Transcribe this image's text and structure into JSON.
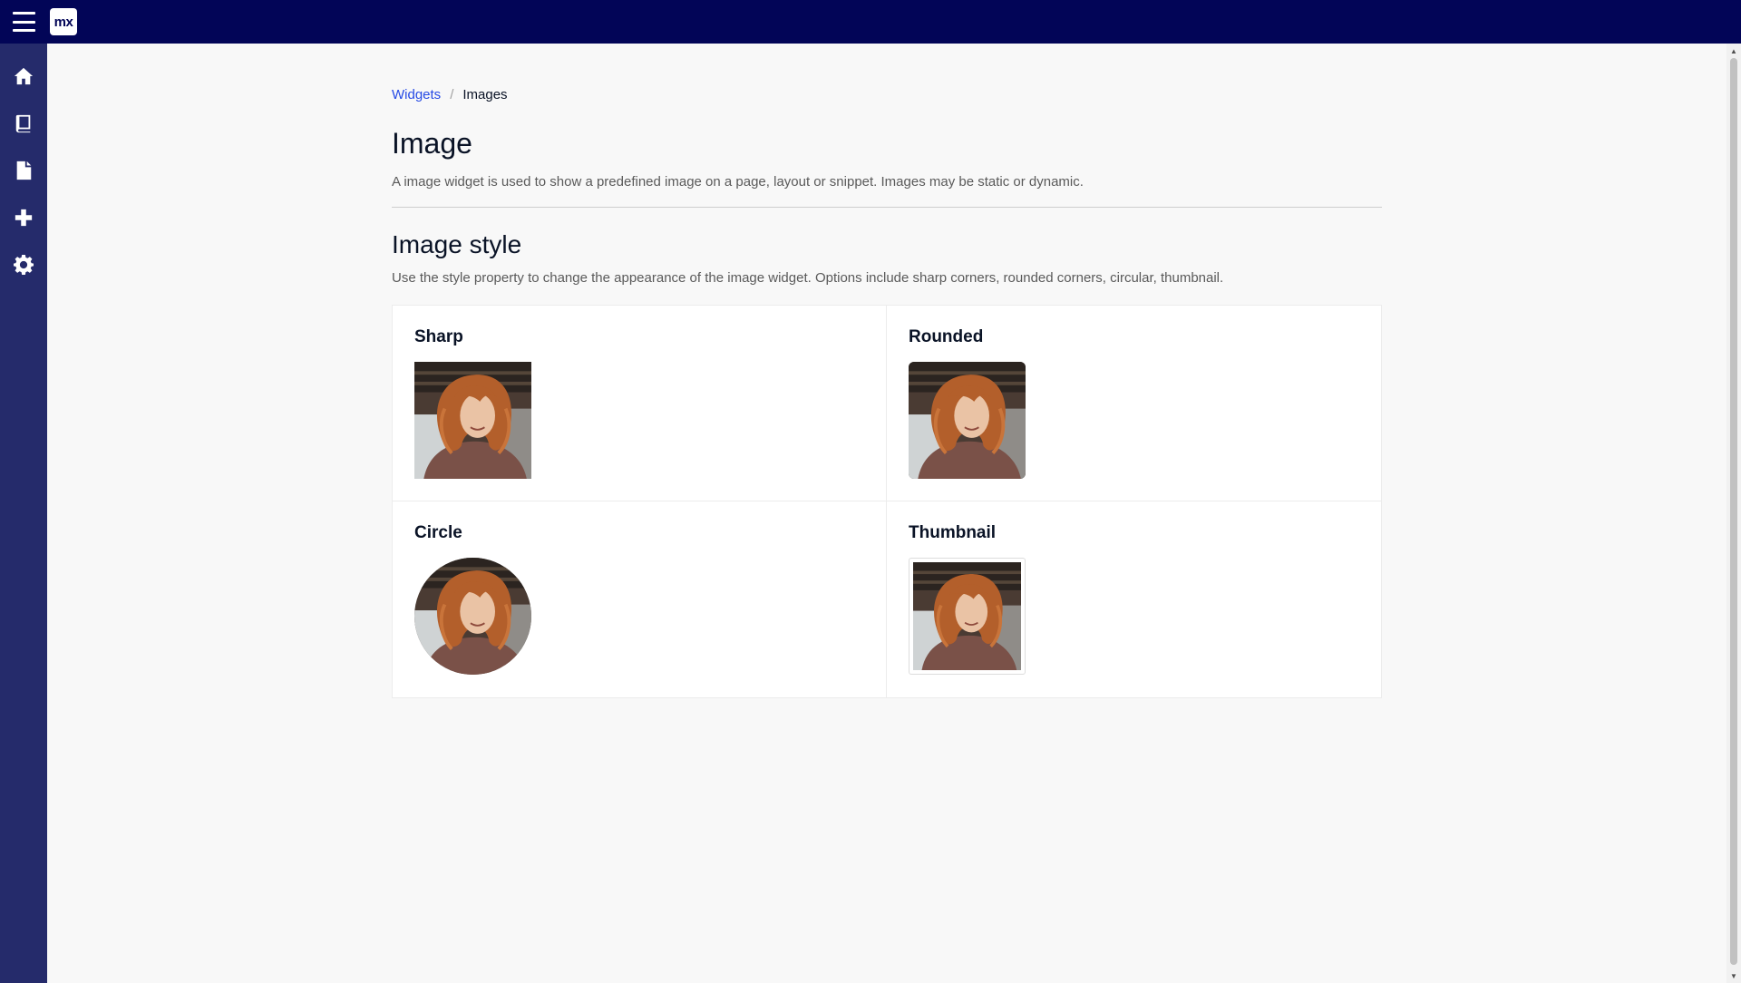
{
  "app": {
    "logo_text": "mx",
    "menu_icon": "hamburger-icon",
    "colors": {
      "topbar": "#020557",
      "sidebar": "#252b6b",
      "link": "#264ae5"
    }
  },
  "sidebar": {
    "items": [
      {
        "name": "home",
        "icon": "home-icon"
      },
      {
        "name": "book",
        "icon": "book-icon"
      },
      {
        "name": "document",
        "icon": "document-icon"
      },
      {
        "name": "add",
        "icon": "plus-icon"
      },
      {
        "name": "settings",
        "icon": "gear-icon"
      }
    ]
  },
  "breadcrumb": {
    "parent": "Widgets",
    "separator": "/",
    "current": "Images"
  },
  "page": {
    "title": "Image",
    "description": "A image widget is used to show a predefined image on a page, layout or snippet. Images may be static or dynamic."
  },
  "section": {
    "title": "Image style",
    "description": "Use the style property to change the appearance of the image widget. Options include sharp corners, rounded corners, circular, thumbnail."
  },
  "styles": [
    {
      "label": "Sharp"
    },
    {
      "label": "Rounded"
    },
    {
      "label": "Circle"
    },
    {
      "label": "Thumbnail"
    }
  ]
}
